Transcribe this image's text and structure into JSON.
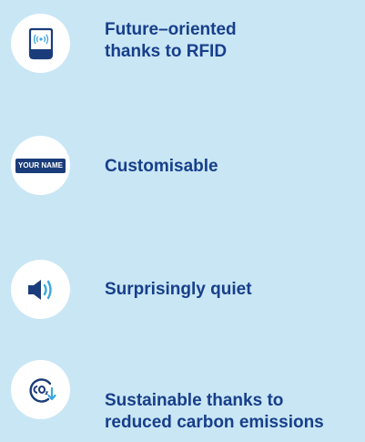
{
  "colors": {
    "background": "#c9e6f5",
    "circle": "#ffffff",
    "text": "#173f8a",
    "icon_navy": "#1b3c7a",
    "icon_accent": "#3aa7e0"
  },
  "features": [
    {
      "icon": "rfid-card-icon",
      "label": "Future–oriented\nthanks to RFID"
    },
    {
      "icon": "your-name-badge-icon",
      "badge_text": "YOUR NAME",
      "label": "Customisable"
    },
    {
      "icon": "speaker-icon",
      "label": "Surprisingly quiet"
    },
    {
      "icon": "co2-reduction-icon",
      "label": "Sustainable thanks to\nreduced carbon emissions"
    }
  ]
}
